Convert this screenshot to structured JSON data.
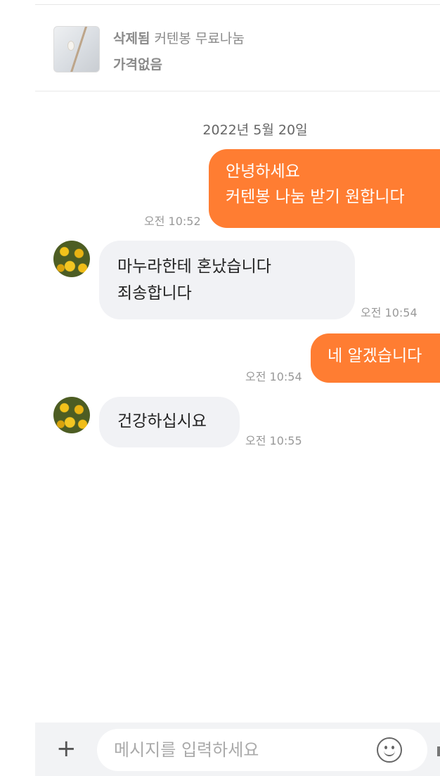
{
  "product": {
    "status": "삭제됨",
    "title": "커텐봉 무료나눔",
    "price": "가격없음"
  },
  "chat": {
    "date": "2022년 5월 20일",
    "messages": [
      {
        "from": "me",
        "lines": [
          "안녕하세요",
          "커텐봉 나눔 받기 원합니다"
        ],
        "time": "오전 10:52"
      },
      {
        "from": "other",
        "lines": [
          "마누라한테 혼났습니다",
          "죄송합니다"
        ],
        "time": "오전 10:54"
      },
      {
        "from": "me",
        "lines": [
          "네 알겠습니다"
        ],
        "time": "오전 10:54"
      },
      {
        "from": "other",
        "lines": [
          "건강하십시요"
        ],
        "time": "오전 10:55"
      }
    ]
  },
  "input": {
    "placeholder": "메시지를 입력하세요",
    "plus_label": "+"
  },
  "colors": {
    "outgoing_bubble": "#ff7d32",
    "incoming_bubble": "#f1f2f5"
  },
  "icons": [
    "plus-icon",
    "emoji-icon",
    "avatar"
  ]
}
